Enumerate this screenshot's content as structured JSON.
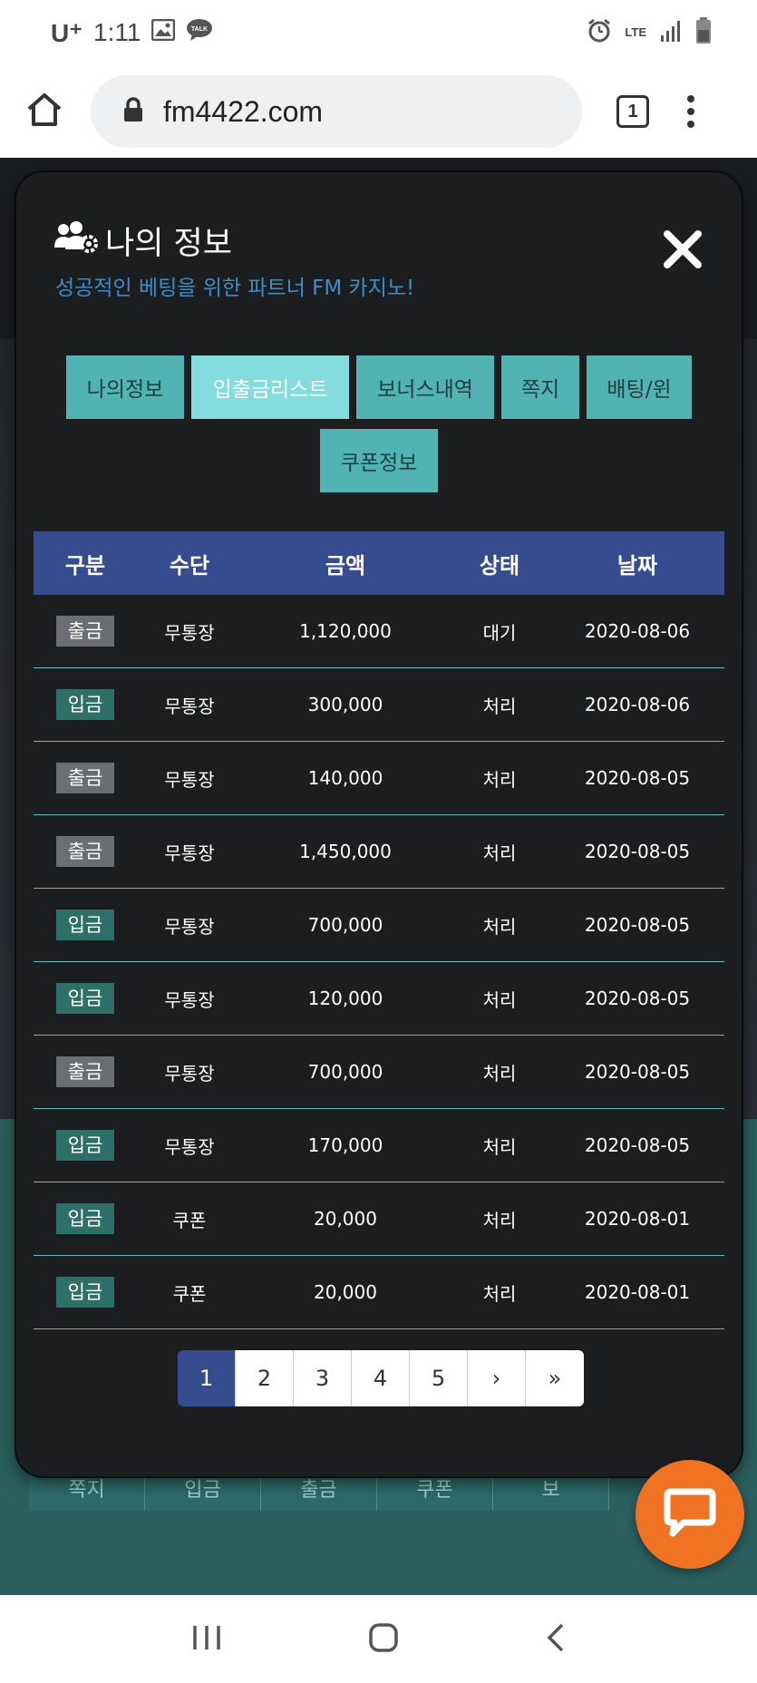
{
  "status_bar": {
    "carrier": "U⁺",
    "time": "1:11",
    "network": "LTE"
  },
  "browser": {
    "url": "fm4422.com",
    "tab_count": "1"
  },
  "background_nav": [
    "쪽지",
    "입금",
    "출금",
    "쿠폰",
    "보"
  ],
  "modal": {
    "title": "나의 정보",
    "subtitle": "성공적인 베팅을 위한 파트너 FM 카지노!",
    "tabs": [
      {
        "label": "나의정보",
        "active": false
      },
      {
        "label": "입출금리스트",
        "active": true
      },
      {
        "label": "보너스내역",
        "active": false
      },
      {
        "label": "쪽지",
        "active": false
      },
      {
        "label": "배팅/윈",
        "active": false
      },
      {
        "label": "쿠폰정보",
        "active": false
      }
    ],
    "table": {
      "headers": [
        "구분",
        "수단",
        "금액",
        "상태",
        "날짜"
      ],
      "rows": [
        {
          "type": "출금",
          "method": "무통장",
          "amount": "1,120,000",
          "status": "대기",
          "date": "2020-08-06"
        },
        {
          "type": "입금",
          "method": "무통장",
          "amount": "300,000",
          "status": "처리",
          "date": "2020-08-06"
        },
        {
          "type": "출금",
          "method": "무통장",
          "amount": "140,000",
          "status": "처리",
          "date": "2020-08-05"
        },
        {
          "type": "출금",
          "method": "무통장",
          "amount": "1,450,000",
          "status": "처리",
          "date": "2020-08-05"
        },
        {
          "type": "입금",
          "method": "무통장",
          "amount": "700,000",
          "status": "처리",
          "date": "2020-08-05"
        },
        {
          "type": "입금",
          "method": "무통장",
          "amount": "120,000",
          "status": "처리",
          "date": "2020-08-05"
        },
        {
          "type": "출금",
          "method": "무통장",
          "amount": "700,000",
          "status": "처리",
          "date": "2020-08-05"
        },
        {
          "type": "입금",
          "method": "무통장",
          "amount": "170,000",
          "status": "처리",
          "date": "2020-08-05"
        },
        {
          "type": "입금",
          "method": "쿠폰",
          "amount": "20,000",
          "status": "처리",
          "date": "2020-08-01"
        },
        {
          "type": "입금",
          "method": "쿠폰",
          "amount": "20,000",
          "status": "처리",
          "date": "2020-08-01"
        }
      ]
    },
    "pagination": [
      "1",
      "2",
      "3",
      "4",
      "5",
      "›",
      "»"
    ],
    "current_page": "1"
  },
  "colors": {
    "table_header": "#374c8f",
    "tab": "#52b3b3",
    "tab_active": "#85dcdc",
    "withdraw_badge": "#6a6e72",
    "deposit_badge": "#2f6f6a",
    "chat_button": "#f07323"
  },
  "icons": [
    "image-icon",
    "talk-icon",
    "alarm-icon",
    "signal-icon",
    "battery-icon",
    "home-icon",
    "lock-icon",
    "more-icon",
    "users-gear-icon",
    "close-icon",
    "chat-icon",
    "recents-icon",
    "home-nav-icon",
    "back-icon"
  ]
}
